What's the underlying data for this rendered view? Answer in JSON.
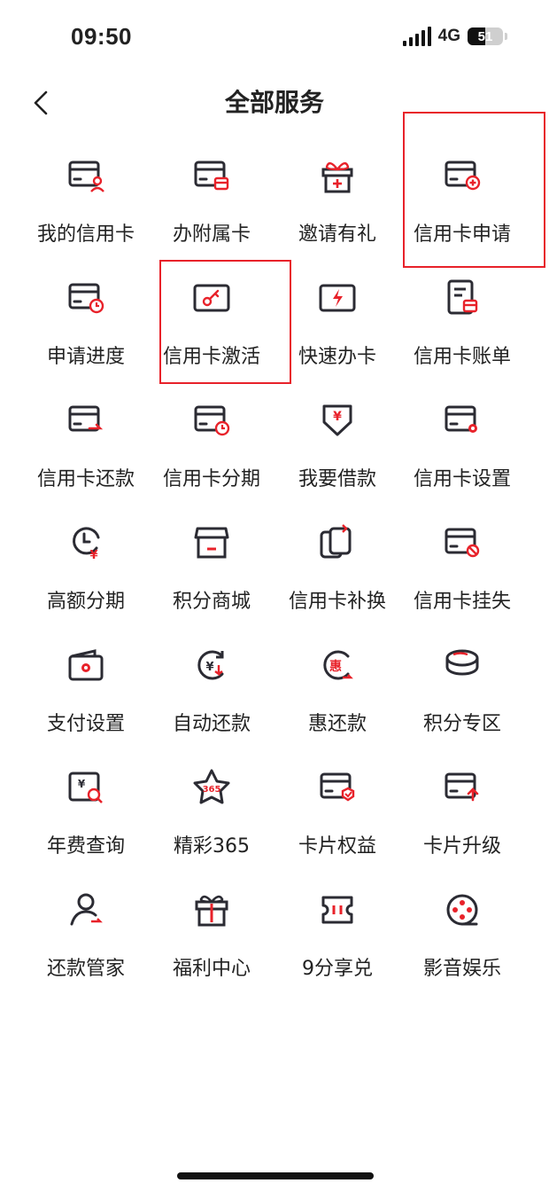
{
  "status_bar": {
    "time": "09:50",
    "network": "4G",
    "battery": "51",
    "battery_level": 0.51
  },
  "header": {
    "title": "全部服务"
  },
  "colors": {
    "accent": "#e8222a",
    "icon_dark": "#2b2b33",
    "highlight_box": "#e8222a"
  },
  "services": [
    {
      "label": "我的信用卡",
      "icon": "card-user-icon"
    },
    {
      "label": "办附属卡",
      "icon": "card-sub-icon"
    },
    {
      "label": "邀请有礼",
      "icon": "gift-box-icon"
    },
    {
      "label": "信用卡申请",
      "icon": "card-add-icon"
    },
    {
      "label": "申请进度",
      "icon": "card-progress-icon"
    },
    {
      "label": "信用卡激活",
      "icon": "card-key-icon"
    },
    {
      "label": "快速办卡",
      "icon": "card-lightning-icon"
    },
    {
      "label": "信用卡账单",
      "icon": "bill-icon"
    },
    {
      "label": "信用卡还款",
      "icon": "card-repay-icon"
    },
    {
      "label": "信用卡分期",
      "icon": "card-clock-icon"
    },
    {
      "label": "我要借款",
      "icon": "yuan-shield-icon"
    },
    {
      "label": "信用卡设置",
      "icon": "card-gear-icon"
    },
    {
      "label": "高额分期",
      "icon": "clock-yuan-icon"
    },
    {
      "label": "积分商城",
      "icon": "store-icon"
    },
    {
      "label": "信用卡补换",
      "icon": "card-swap-icon"
    },
    {
      "label": "信用卡挂失",
      "icon": "card-block-icon"
    },
    {
      "label": "支付设置",
      "icon": "wallet-gear-icon"
    },
    {
      "label": "自动还款",
      "icon": "auto-repay-icon"
    },
    {
      "label": "惠还款",
      "icon": "hui-repay-icon"
    },
    {
      "label": "积分专区",
      "icon": "coins-icon"
    },
    {
      "label": "年费查询",
      "icon": "fee-search-icon"
    },
    {
      "label": "精彩365",
      "icon": "star-365-icon"
    },
    {
      "label": "卡片权益",
      "icon": "card-badge-icon"
    },
    {
      "label": "卡片升级",
      "icon": "card-upgrade-icon"
    },
    {
      "label": "还款管家",
      "icon": "person-repay-icon"
    },
    {
      "label": "福利中心",
      "icon": "gift-icon"
    },
    {
      "label": "9分享兑",
      "icon": "ticket-icon"
    },
    {
      "label": "影音娱乐",
      "icon": "film-reel-icon"
    }
  ],
  "highlights": [
    3,
    5
  ]
}
